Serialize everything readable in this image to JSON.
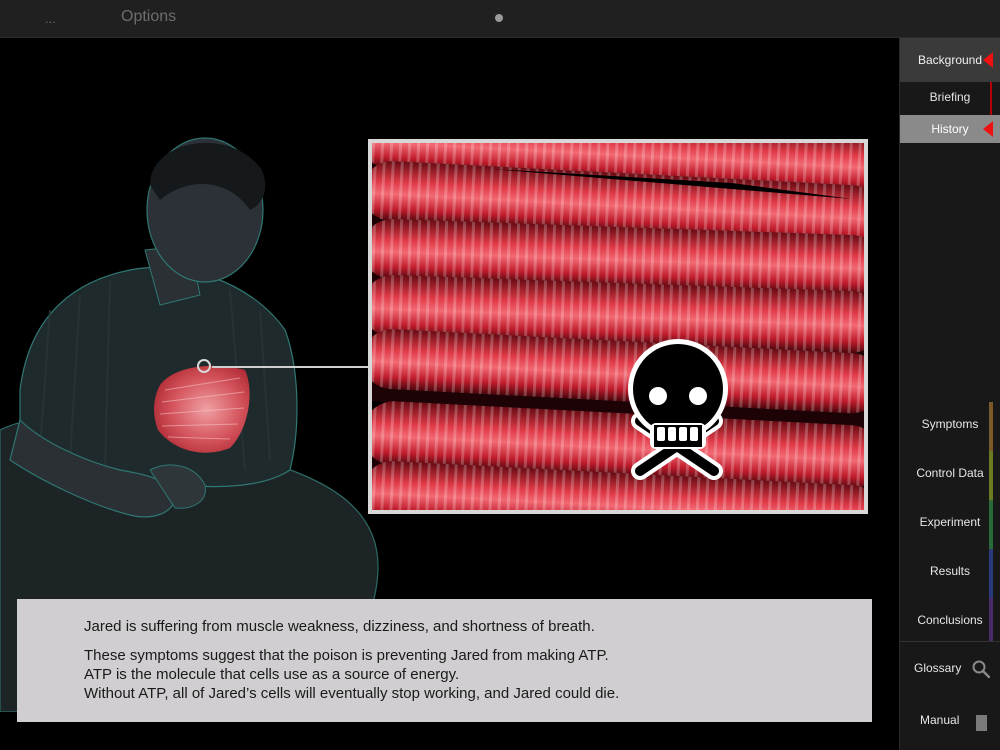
{
  "topbar": {
    "menu_label": "...",
    "options_label": "Options"
  },
  "caption": {
    "paragraph1": "Jared is suffering from muscle weakness, dizziness, and shortness of breath.",
    "line2": "These symptoms suggest that the poison is preventing Jared from making ATP.",
    "line3": "ATP is the molecule that cells use as a source of energy.",
    "line4": "Without ATP, all of Jared’s cells will eventually stop working, and Jared could die."
  },
  "sidebar": {
    "top_items": [
      {
        "label": "Background",
        "state": "section-active"
      },
      {
        "label": "Briefing"
      },
      {
        "label": "History",
        "state": "selected"
      }
    ],
    "sections": [
      {
        "label": "Symptoms",
        "color": "#7a5a2a"
      },
      {
        "label": "Control Data",
        "color": "#6a7a20"
      },
      {
        "label": "Experiment",
        "color": "#2a6a3a"
      },
      {
        "label": "Results",
        "color": "#2a3a7a"
      },
      {
        "label": "Conclusions",
        "color": "#4a2a6a"
      }
    ],
    "glossary_label": "Glossary",
    "manual_label": "Manual"
  },
  "colors": {
    "accent_red": "#ee1111",
    "muscle_red": "#c81a28",
    "caption_bg": "#d0ced0"
  },
  "icons": [
    "search-icon",
    "book-icon",
    "skull-crossbones-icon"
  ]
}
